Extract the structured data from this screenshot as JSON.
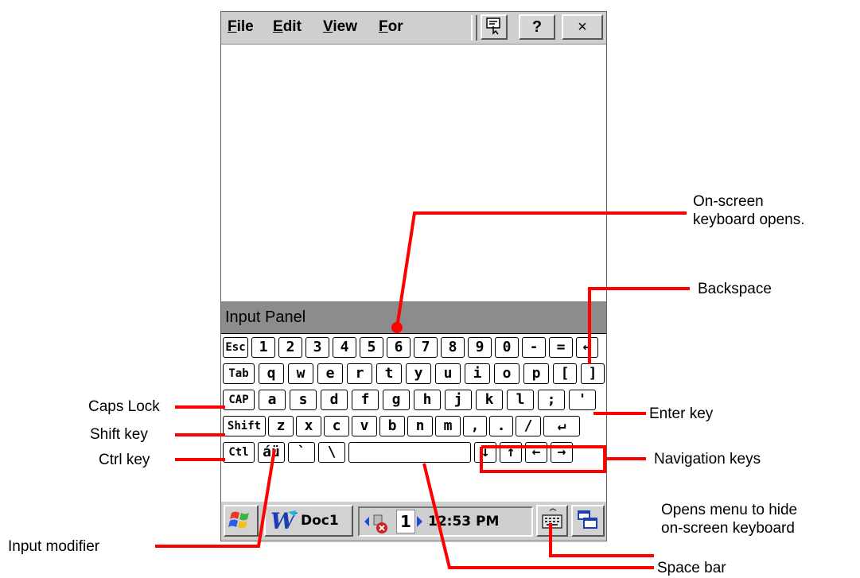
{
  "menu": {
    "file": "File",
    "edit": "Edit",
    "view": "View",
    "format": "For",
    "help": "?",
    "close": "×"
  },
  "input_panel": {
    "title": "Input Panel"
  },
  "keyboard": {
    "row1": [
      "Esc",
      "1",
      "2",
      "3",
      "4",
      "5",
      "6",
      "7",
      "8",
      "9",
      "0",
      "-",
      "=",
      "←"
    ],
    "row2": [
      "Tab",
      "q",
      "w",
      "e",
      "r",
      "t",
      "y",
      "u",
      "i",
      "o",
      "p",
      "[",
      "]"
    ],
    "row3": [
      "CAP",
      "a",
      "s",
      "d",
      "f",
      "g",
      "h",
      "j",
      "k",
      "l",
      ";",
      "'"
    ],
    "row4": [
      "Shift",
      "z",
      "x",
      "c",
      "v",
      "b",
      "n",
      "m",
      ",",
      ".",
      "/",
      "↵"
    ],
    "row5": [
      "Ctl",
      "áü",
      "`",
      "\\",
      "",
      "↓",
      "↑",
      "←",
      "→"
    ]
  },
  "taskbar": {
    "doc_label": "Doc1",
    "page_number": "1",
    "time": "12:53 PM"
  },
  "annotations": {
    "onscreen_opens": "On-screen\nkeyboard opens.",
    "backspace": "Backspace",
    "caps_lock": "Caps Lock",
    "shift_key": "Shift key",
    "ctrl_key": "Ctrl key",
    "enter_key": "Enter key",
    "navigation_keys": "Navigation keys",
    "opens_menu": "Opens menu to hide\non-screen keyboard",
    "input_modifier": "Input modifier",
    "space_bar": "Space bar"
  },
  "colors": {
    "annotation_red": "#ff0000",
    "panel_gray": "#8c8c8c",
    "bar_gray": "#cfcfcf"
  }
}
